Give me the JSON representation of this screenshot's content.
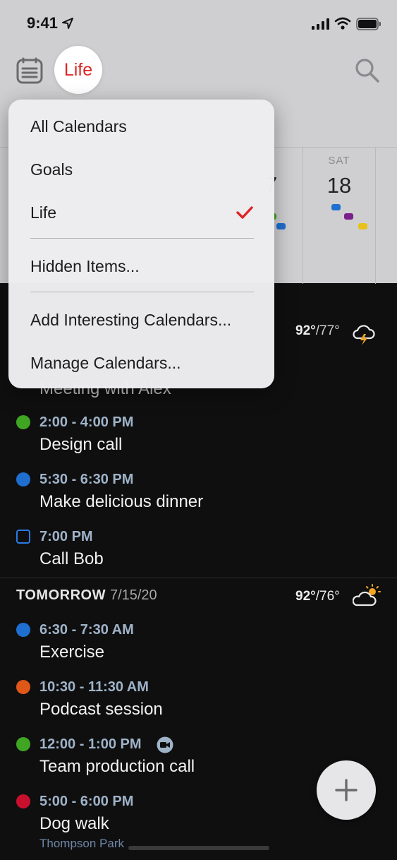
{
  "status_bar": {
    "time": "9:41"
  },
  "header": {
    "calendar_chip": "Life"
  },
  "week": {
    "visible_days": [
      {
        "name": "SAT",
        "number": "18"
      }
    ],
    "partial_day_number": "7"
  },
  "menu": {
    "items": [
      {
        "label": "All Calendars"
      },
      {
        "label": "Goals"
      },
      {
        "label": "Life",
        "checked": true
      },
      {
        "label": "Hidden Items..."
      },
      {
        "label": "Add Interesting Calendars..."
      },
      {
        "label": "Manage Calendars..."
      }
    ]
  },
  "today": {
    "weather": {
      "high": "92°",
      "low": "/77°",
      "icon": "thunderstorm-icon"
    },
    "partial_event_title": "Meeting with Alex",
    "events": [
      {
        "time": "2:00 - 4:00 PM",
        "title": "Design call",
        "color": "#3fa522",
        "kind": "event"
      },
      {
        "time": "5:30 - 6:30 PM",
        "title": "Make delicious dinner",
        "color": "#1f6fd0",
        "kind": "event"
      },
      {
        "time": "7:00 PM",
        "title": "Call Bob",
        "color": "#2a7ae2",
        "kind": "task"
      }
    ]
  },
  "tomorrow": {
    "label": "TOMORROW",
    "date": "7/15/20",
    "weather": {
      "high": "92°",
      "low": "/76°",
      "icon": "partly-cloudy-icon"
    },
    "events": [
      {
        "time": "6:30 - 7:30 AM",
        "title": "Exercise",
        "color": "#1f6fd0"
      },
      {
        "time": "10:30 - 11:30 AM",
        "title": "Podcast session",
        "color": "#e0571a"
      },
      {
        "time": "12:00 - 1:00 PM",
        "title": "Team production call",
        "color": "#3fa522",
        "video": true
      },
      {
        "time": "5:00 - 6:00 PM",
        "title": "Dog walk",
        "color": "#c8102e",
        "location": "Thompson Park"
      }
    ]
  },
  "colors": {
    "accent_red": "#e02424",
    "mark_blue": "#1f6fd0",
    "mark_purple": "#7a1f8c",
    "mark_yellow": "#e8c21a",
    "mark_green": "#3fa522"
  }
}
